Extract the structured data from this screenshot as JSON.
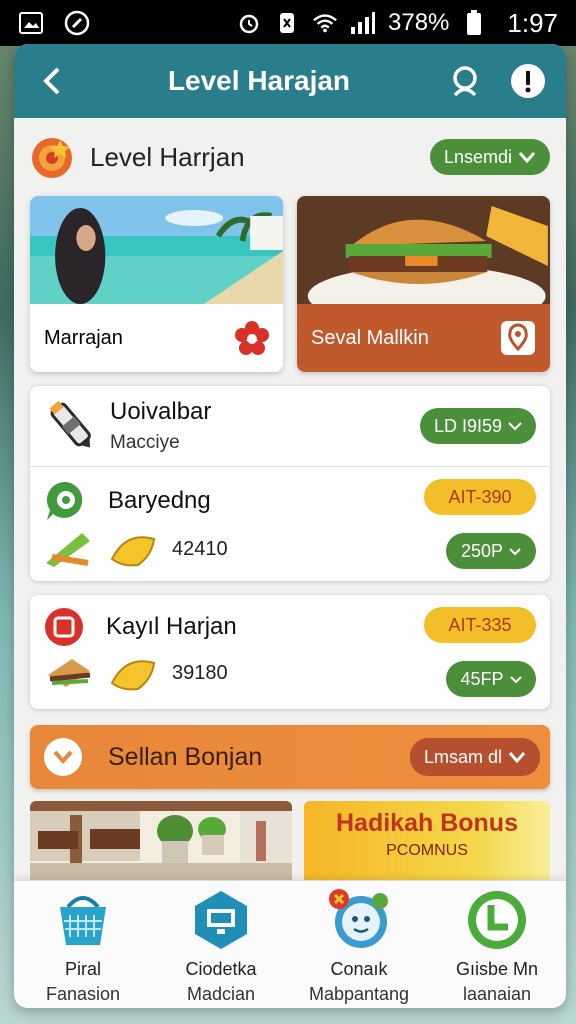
{
  "status_bar": {
    "battery": "378%",
    "time": "1:97"
  },
  "app_bar": {
    "title": "Level Harajan"
  },
  "header": {
    "title": "Level Harrjan",
    "dropdown_label": "Lnsemdi"
  },
  "featured_cards": [
    {
      "caption": "Marrajan"
    },
    {
      "caption": "Seval Mallkin"
    }
  ],
  "list_a": {
    "items": [
      {
        "name": "Uoivalbar",
        "sub": "Macciye",
        "badge": "LD I9I59"
      },
      {
        "name": "Baryedng",
        "badge": "AIT-390",
        "value": "42410",
        "price": "250P"
      }
    ]
  },
  "list_b": {
    "items": [
      {
        "name": "Kayıl Harjan",
        "badge": "AIT-335",
        "value": "39180",
        "price": "45FP"
      }
    ]
  },
  "section": {
    "title": "Sellan Bonjan",
    "dropdown_label": "Lmsam dl"
  },
  "promo": {
    "title": "Hadikah Bonus",
    "subtitle": "PCOMNUS"
  },
  "bottom_nav": [
    {
      "line1": "Piral",
      "line2": "Fanasion",
      "icon": "basket-icon"
    },
    {
      "line1": "Ciodetka",
      "line2": "Madcian",
      "icon": "monitor-icon"
    },
    {
      "line1": "Conaık",
      "line2": "Mabpantang",
      "icon": "chat-icon"
    },
    {
      "line1": "Gıisbe Mn",
      "line2": "laanaian",
      "icon": "refresh-icon"
    }
  ]
}
